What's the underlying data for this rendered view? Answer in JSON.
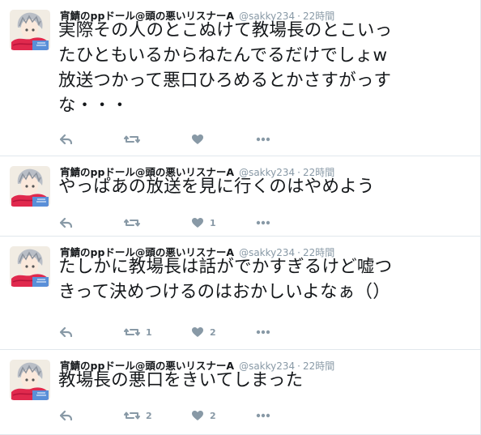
{
  "tweets": [
    {
      "name": "宵鯖のppドール@頭の悪いリスナーA",
      "handle": "@sakky234",
      "time": "22時間",
      "text_lines": [
        "実際その人のとこぬけて教場長のとこいっ",
        "たひともいるからねたんでるだけでしょw",
        "放送つかって悪口ひろめるとかさすがっす",
        "な・・・"
      ],
      "reply_icon": "reply-icon",
      "retweet_icon": "retweet-icon",
      "retweet_count": "",
      "like_icon": "heart-icon",
      "like_count": "",
      "more_icon": "more-icon"
    },
    {
      "name": "宵鯖のppドール@頭の悪いリスナーA",
      "handle": "@sakky234",
      "time": "22時間",
      "text_lines": [
        "やっぱあの放送を見に行くのはやめよう"
      ],
      "reply_icon": "reply-icon",
      "retweet_icon": "retweet-icon",
      "retweet_count": "",
      "like_icon": "heart-icon",
      "like_count": "1",
      "more_icon": "more-icon"
    },
    {
      "name": "宵鯖のppドール@頭の悪いリスナーA",
      "handle": "@sakky234",
      "time": "22時間",
      "text_lines": [
        "たしかに教場長は話がでかすぎるけど嘘つ",
        "きって決めつけるのはおかしいよなぁ（）"
      ],
      "reply_icon": "reply-icon",
      "retweet_icon": "retweet-icon",
      "retweet_count": "1",
      "like_icon": "heart-icon",
      "like_count": "2",
      "more_icon": "more-icon"
    },
    {
      "name": "宵鯖のppドール@頭の悪いリスナーA",
      "handle": "@sakky234",
      "time": "22時間",
      "text_lines": [
        "教場長の悪口をきいてしまった"
      ],
      "reply_icon": "reply-icon",
      "retweet_icon": "retweet-icon",
      "retweet_count": "2",
      "like_icon": "heart-icon",
      "like_count": "2",
      "more_icon": "more-icon"
    }
  ],
  "colors": {
    "icon": "#8899a6",
    "border": "#e1e8ed",
    "text": "#14171a",
    "avatar_scarf": "#e0294d"
  }
}
